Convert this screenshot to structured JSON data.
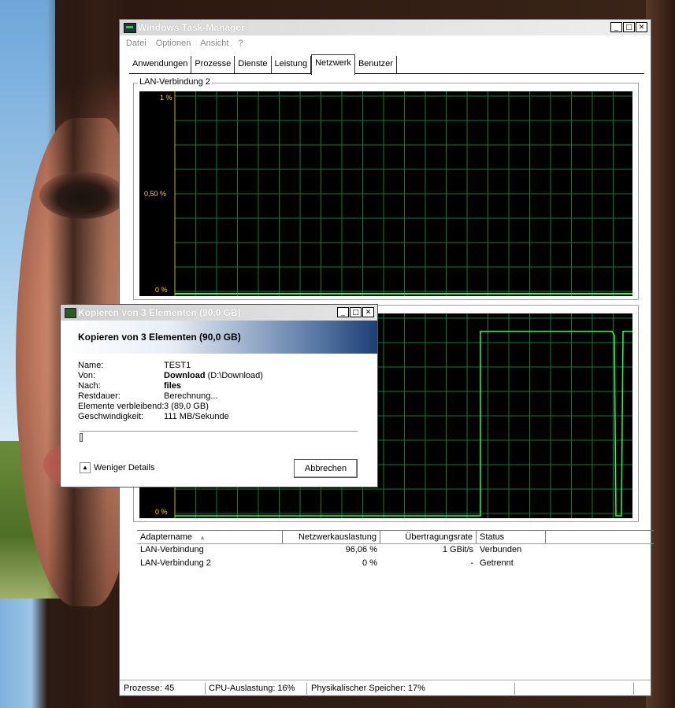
{
  "taskmanager": {
    "title": "Windows Task-Manager",
    "menu": [
      "Datei",
      "Optionen",
      "Ansicht",
      "?"
    ],
    "tabs": [
      "Anwendungen",
      "Prozesse",
      "Dienste",
      "Leistung",
      "Netzwerk",
      "Benutzer"
    ],
    "active_tab": "Netzwerk",
    "graph1": {
      "label": "LAN-Verbindung 2",
      "y_top": "1 %",
      "y_mid": "0,50 %",
      "y_bottom": "0 %",
      "chart_data": {
        "type": "line",
        "ylim": [
          0,
          1
        ],
        "values": [
          0,
          0,
          0,
          0,
          0,
          0
        ]
      }
    },
    "graph2": {
      "y_bottom": "0 %",
      "chart_data": {
        "type": "line",
        "ylim": [
          0,
          100
        ],
        "description_values": [
          0,
          0,
          0,
          0,
          96,
          96,
          96,
          96,
          94,
          96,
          0,
          96
        ]
      }
    },
    "list": {
      "headers": [
        "Adaptername",
        "Netzwerkauslastung",
        "Übertragungsrate",
        "Status"
      ],
      "sort_indicator": "▲",
      "rows": [
        {
          "name": "LAN-Verbindung",
          "usage": "96,06 %",
          "rate": "1 GBit/s",
          "status": "Verbunden"
        },
        {
          "name": "LAN-Verbindung 2",
          "usage": "0 %",
          "rate": "-",
          "status": "Getrennt"
        }
      ]
    },
    "statusbar": {
      "processes": "Prozesse: 45",
      "cpu": "CPU-Auslastung: 16%",
      "memory": "Physikalischer Speicher: 17%"
    },
    "window_buttons": {
      "minimize": "_",
      "maximize": "□",
      "close": "✕"
    }
  },
  "copy_dialog": {
    "title": "Kopieren von 3 Elementen (90,0 GB)",
    "heading": "Kopieren von 3 Elementen (90,0 GB)",
    "fields": [
      {
        "key": "Name:",
        "value": "TEST1"
      },
      {
        "key": "Von:",
        "value_bold": "Download",
        "value": "(D:\\Download)"
      },
      {
        "key": "Nach:",
        "value_bold": "files",
        "value": ""
      },
      {
        "key": "Restdauer:",
        "value": "Berechnung..."
      },
      {
        "key": "Elemente verbleibend:",
        "value": "3 (89,0 GB)"
      },
      {
        "key": "Geschwindigkeit:",
        "value": "111 MB/Sekunde"
      }
    ],
    "progress": 0.01,
    "less_details": "Weniger Details",
    "cancel": "Abbrechen"
  }
}
